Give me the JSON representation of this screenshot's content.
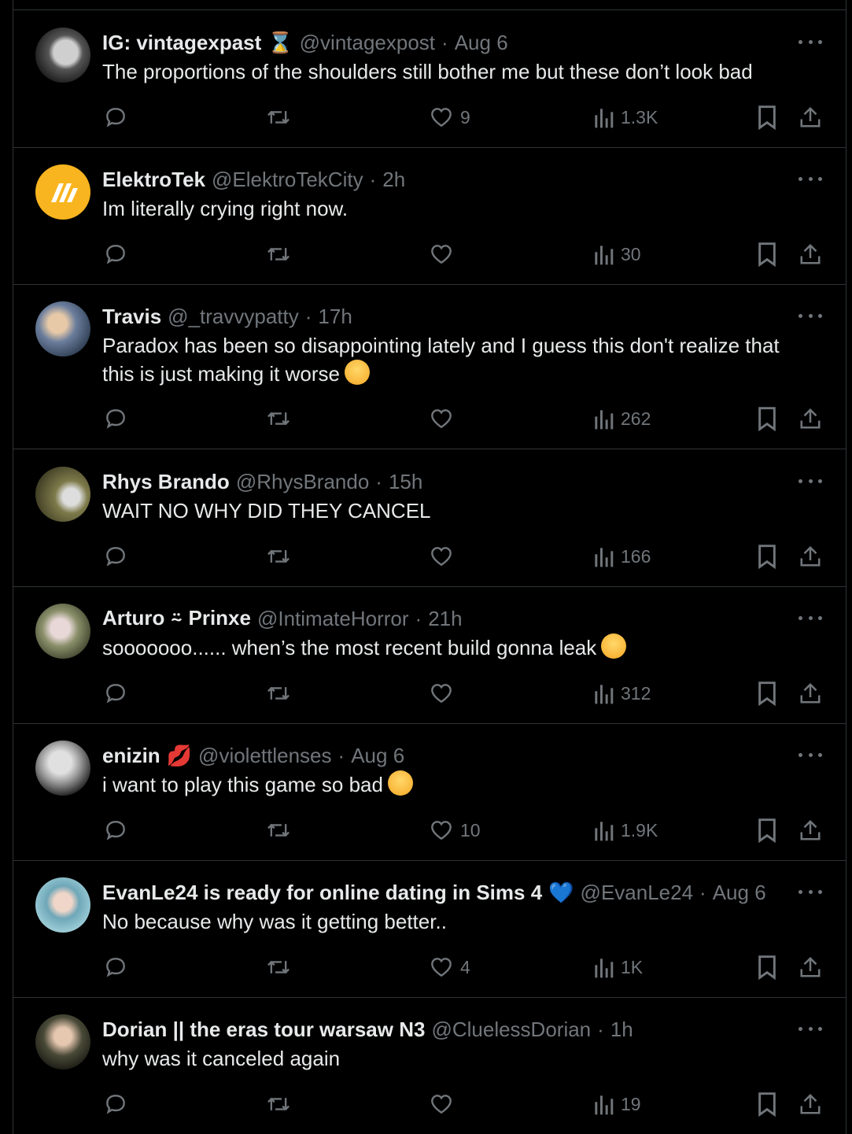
{
  "posts": [
    {
      "name": "IG: vintagexpast",
      "badge": "⌛",
      "handle": "@vintagexpost",
      "time": "Aug 6",
      "text": "The proportions of the shoulders still bother me but these don’t look bad",
      "likes": "9",
      "views": "1.3K"
    },
    {
      "name": "ElektroTek",
      "badge": "",
      "handle": "@ElektroTekCity",
      "time": "2h",
      "text": "Im literally crying right now.",
      "likes": "",
      "views": "30"
    },
    {
      "name": "Travis",
      "badge": "",
      "handle": "@_travvypatty",
      "time": "17h",
      "text": "Paradox has been so disappointing lately and I guess this don't realize that this is just making it worse",
      "emoji": "crying-face",
      "likes": "",
      "views": "262"
    },
    {
      "name": "Rhys Brando",
      "badge": "",
      "handle": "@RhysBrando",
      "time": "15h",
      "text": "WAIT NO WHY DID THEY CANCEL",
      "likes": "",
      "views": "166"
    },
    {
      "name": "Arturo ⍨ Prinxe",
      "badge": "",
      "handle": "@IntimateHorror",
      "time": "21h",
      "text": "sooooooo...... when’s the most recent build gonna leak",
      "emoji": "hand-over-mouth-face",
      "likes": "",
      "views": "312"
    },
    {
      "name": "enizin",
      "badge": "💋",
      "handle": "@violettlenses",
      "time": "Aug 6",
      "text": "i want to play this game so bad",
      "emoji": "crying-face",
      "likes": "10",
      "views": "1.9K"
    },
    {
      "name": "EvanLe24 is ready for online dating in Sims 4",
      "badge": "💙",
      "handle": "@EvanLe24",
      "time": "Aug 6",
      "text": "No because why was it getting better..",
      "likes": "4",
      "views": "1K"
    },
    {
      "name": "Dorian || the eras tour warsaw N3",
      "badge": "",
      "handle": "@CluelessDorian",
      "time": "1h",
      "text": "why was it canceled again",
      "likes": "",
      "views": "19"
    }
  ],
  "separator": "·",
  "colors": {
    "background": "#000000",
    "text": "#e7e9ea",
    "muted": "#71767b",
    "border": "#2f3336"
  }
}
